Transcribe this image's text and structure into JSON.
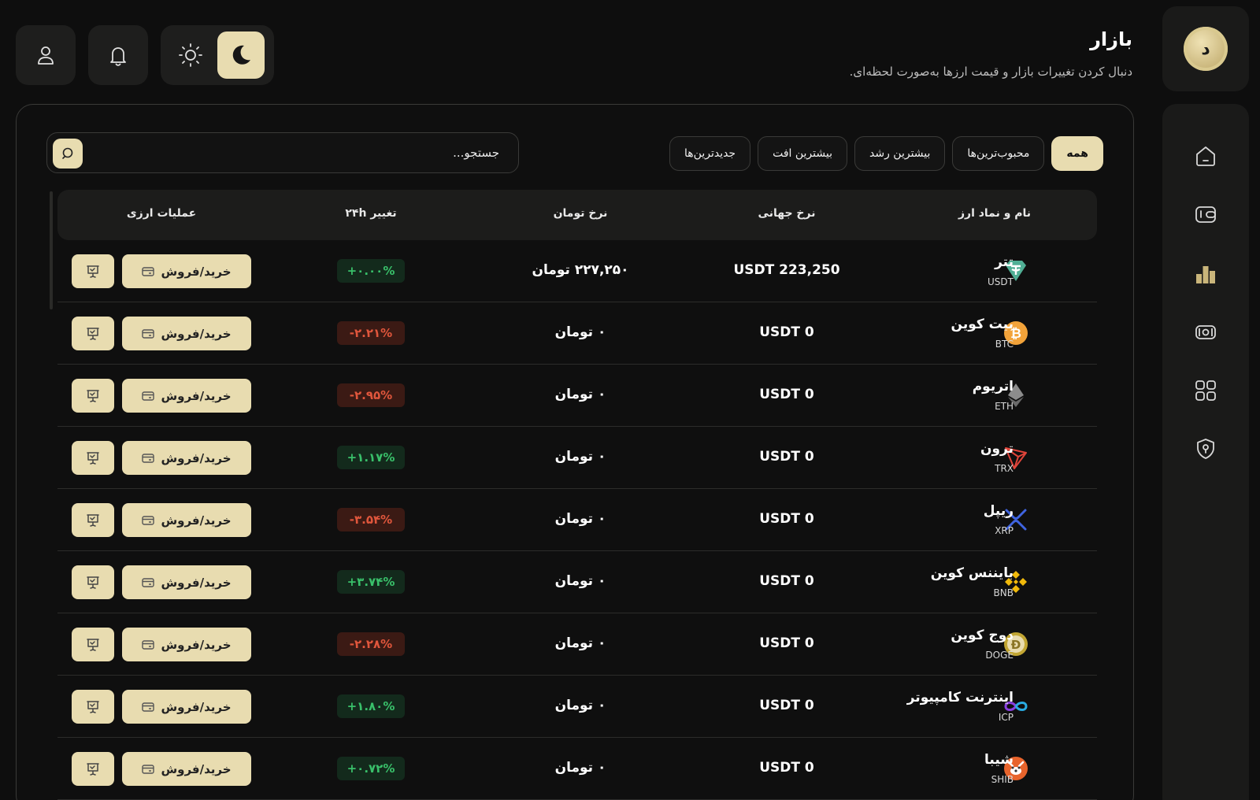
{
  "header": {
    "title": "بازار",
    "subtitle": "دنبال کردن تغییرات بازار و قیمت ارزها به‌صورت لحظه‌ای."
  },
  "brand": {
    "logo_letter": "د",
    "accent": "#e8dcb0"
  },
  "sidebar": {
    "items": [
      {
        "icon": "home-icon"
      },
      {
        "icon": "wallet-icon"
      },
      {
        "icon": "bar-chart-icon"
      },
      {
        "icon": "cash-icon"
      },
      {
        "icon": "grid-icon"
      },
      {
        "icon": "shield-icon"
      }
    ]
  },
  "filters": [
    {
      "label": "همه",
      "active": true
    },
    {
      "label": "محبوب‌ترین‌ها",
      "active": false
    },
    {
      "label": "بیشترین رشد",
      "active": false
    },
    {
      "label": "بیشترین افت",
      "active": false
    },
    {
      "label": "جدیدترین‌ها",
      "active": false
    }
  ],
  "search": {
    "placeholder": "جستجو..."
  },
  "table": {
    "headers": {
      "name": "نام و نماد ارز",
      "global": "نرخ جهانی",
      "toman": "نرخ تومان",
      "change": "تغییر ۲۴h",
      "actions": "عملیات ارزی"
    },
    "trade_label": "خرید/فروش",
    "rows": [
      {
        "name": "تتر",
        "symbol": "USDT",
        "global": "223,250 USDT",
        "toman": "۲۲۷,۲۵۰ تومان",
        "change": "+۰.۰۰%",
        "dir": "up",
        "icon": "tether-icon",
        "color": "#50af95"
      },
      {
        "name": "بیت کوین",
        "symbol": "BTC",
        "global": "0 USDT",
        "toman": "۰ تومان",
        "change": "-۲.۲۱%",
        "dir": "down",
        "icon": "bitcoin-icon",
        "color": "#f2a33a"
      },
      {
        "name": "اتریوم",
        "symbol": "ETH",
        "global": "0 USDT",
        "toman": "۰ تومان",
        "change": "-۲.۹۵%",
        "dir": "down",
        "icon": "ethereum-icon",
        "color": "#8c8c8c"
      },
      {
        "name": "ترون",
        "symbol": "TRX",
        "global": "0 USDT",
        "toman": "۰ تومان",
        "change": "+۱.۱۷%",
        "dir": "up",
        "icon": "tron-icon",
        "color": "#e0443a"
      },
      {
        "name": "ریپل",
        "symbol": "XRP",
        "global": "0 USDT",
        "toman": "۰ تومان",
        "change": "-۳.۵۴%",
        "dir": "down",
        "icon": "xrp-icon",
        "color": "#3f64e0"
      },
      {
        "name": "بایننس کوین",
        "symbol": "BNB",
        "global": "0 USDT",
        "toman": "۰ تومان",
        "change": "+۳.۷۴%",
        "dir": "up",
        "icon": "bnb-icon",
        "color": "#f0b90b"
      },
      {
        "name": "دوج کوین",
        "symbol": "DOGE",
        "global": "0 USDT",
        "toman": "۰ تومان",
        "change": "-۲.۲۸%",
        "dir": "down",
        "icon": "dogecoin-icon",
        "color": "#c2a633"
      },
      {
        "name": "اینترنت کامپیوتر",
        "symbol": "ICP",
        "global": "0 USDT",
        "toman": "۰ تومان",
        "change": "+۱.۸۰%",
        "dir": "up",
        "icon": "icp-icon",
        "color": "#29abe2"
      },
      {
        "name": "شیبا",
        "symbol": "SHIB",
        "global": "0 USDT",
        "toman": "۰ تومان",
        "change": "+۰.۷۲%",
        "dir": "up",
        "icon": "shiba-icon",
        "color": "#e8642c"
      }
    ]
  }
}
